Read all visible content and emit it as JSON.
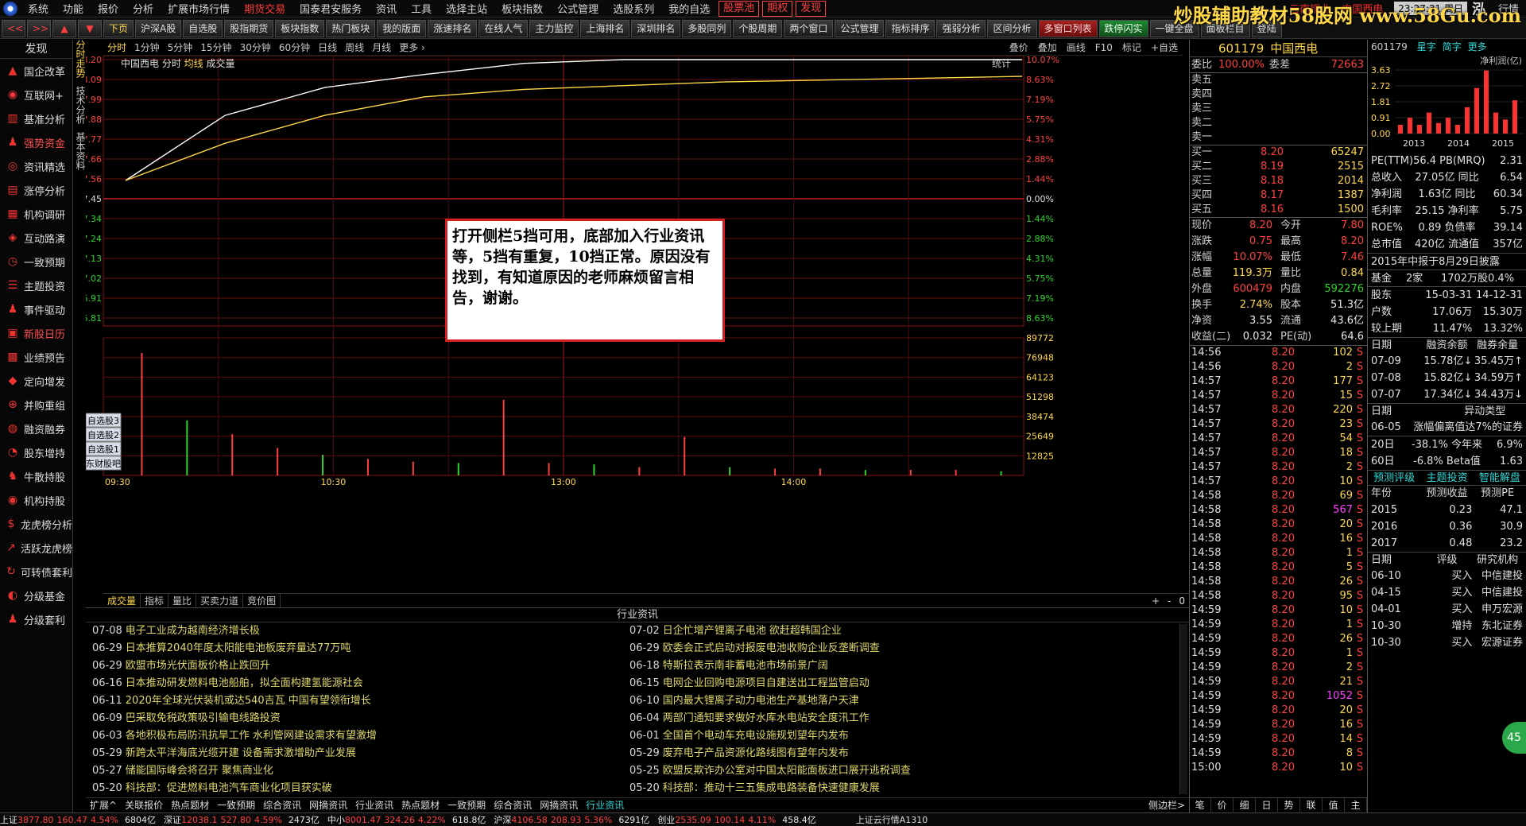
{
  "menubar": {
    "items": [
      "系统",
      "功能",
      "报价",
      "分析",
      "扩展市场行情",
      "期货交易",
      "国泰君安服务",
      "资讯",
      "工具",
      "选择主站",
      "板块指数",
      "公式管理",
      "选股系列",
      "我的自选"
    ],
    "red_items": [
      "期货交易"
    ],
    "boxed_items": [
      "股票池",
      "期权",
      "发现"
    ],
    "ticker": [
      "云南铜业",
      "中国西电"
    ],
    "clock": "23:27:31 周日",
    "brand": "泓",
    "market_tab": "行情"
  },
  "watermark": "炒股辅助教材58股网 www.58Gu.com",
  "toolbar": {
    "nav": [
      "<<",
      ">>",
      "▲",
      "▼"
    ],
    "buttons": [
      "下页",
      "沪深A股",
      "自选股",
      "股指期货",
      "板块指数",
      "热门板块",
      "我的版面",
      "涨速排名",
      "在线人气",
      "主力监控",
      "上海排名",
      "深圳排名",
      "多股同列",
      "个股周期",
      "两个窗口",
      "公式管理",
      "指标排序",
      "强弱分析",
      "区间分析"
    ],
    "red_button": "多窗口列表",
    "green_button": "跌停闪实",
    "tail_buttons": [
      "一键全盘",
      "面板栏目",
      "登陆"
    ]
  },
  "sidebar": {
    "header": "发现",
    "items": [
      {
        "icon": "chart-icon",
        "label": "国企改革"
      },
      {
        "icon": "globe-icon",
        "label": "互联网+"
      },
      {
        "icon": "bars-icon",
        "label": "基准分析"
      },
      {
        "icon": "person-icon",
        "label": "强势资金"
      },
      {
        "icon": "target-icon",
        "label": "资讯精选"
      },
      {
        "icon": "doc-icon",
        "label": "涨停分析"
      },
      {
        "icon": "building-icon",
        "label": "机构调研"
      },
      {
        "icon": "bag-icon",
        "label": "互动路演"
      },
      {
        "icon": "alarm-icon",
        "label": "一致预期"
      },
      {
        "icon": "list-icon",
        "label": "主题投资"
      },
      {
        "icon": "person-icon",
        "label": "事件驱动"
      },
      {
        "icon": "calendar-icon",
        "label": "新股日历"
      },
      {
        "icon": "grid-icon",
        "label": "业绩预告"
      },
      {
        "icon": "tag-icon",
        "label": "定向增发"
      },
      {
        "icon": "merge-icon",
        "label": "并购重组"
      },
      {
        "icon": "coin-icon",
        "label": "融资融券"
      },
      {
        "icon": "pie-icon",
        "label": "股东增持"
      },
      {
        "icon": "bull-icon",
        "label": "牛散持股"
      },
      {
        "icon": "globe-icon",
        "label": "机构持股"
      },
      {
        "icon": "dollar-icon",
        "label": "龙虎榜分析"
      },
      {
        "icon": "line-icon",
        "label": "活跃龙虎榜"
      },
      {
        "icon": "cycle-icon",
        "label": "可转债套利"
      },
      {
        "icon": "fund-icon",
        "label": "分级基金"
      },
      {
        "icon": "person-icon",
        "label": "分级套利"
      }
    ]
  },
  "vtabs": [
    "分时走势",
    "技术分析",
    "基本资料"
  ],
  "period": {
    "tabs": [
      "分时",
      "1分钟",
      "5分钟",
      "15分钟",
      "30分钟",
      "60分钟",
      "日线",
      "周线",
      "月线",
      "更多 ›"
    ],
    "active": "分时",
    "tools": [
      "叠价",
      "叠加",
      "画线",
      "F10",
      "标记",
      "+自选"
    ]
  },
  "chart": {
    "legend": {
      "name": "中国西电",
      "view": "分时",
      "avg": "均线",
      "vol": "成交量"
    },
    "stat_label": "统计",
    "y_labels": [
      "8.20",
      "8.09",
      "7.99",
      "7.88",
      "7.77",
      "7.66",
      "7.56",
      "7.45",
      "7.34",
      "7.24",
      "7.13",
      "7.02",
      "6.91",
      "6.81"
    ],
    "pct_labels": [
      "10.07%",
      "8.63%",
      "7.19%",
      "5.75%",
      "4.31%",
      "2.88%",
      "1.44%",
      "0.00%",
      "1.44%",
      "2.88%",
      "4.31%",
      "5.75%",
      "7.19%",
      "8.63%"
    ],
    "vol_labels": [
      "89772",
      "76948",
      "64123",
      "51298",
      "38474",
      "25649",
      "12825"
    ],
    "time_labels": [
      "09:30",
      "10:30",
      "13:00",
      "14:00"
    ],
    "selfselect": [
      "自选股3",
      "自选股2",
      "自选股1",
      "东财股吧"
    ]
  },
  "chart_data": {
    "type": "line",
    "x": [
      "09:30",
      "10:30",
      "13:00",
      "14:00",
      "15:00"
    ],
    "ylim": [
      6.7,
      8.2
    ],
    "prev_close": 7.45,
    "series": [
      {
        "values": [
          7.55,
          7.9,
          8.05,
          8.12,
          8.18,
          8.2,
          8.2,
          8.2,
          8.2,
          8.2
        ]
      },
      {
        "values": [
          7.55,
          7.75,
          7.9,
          8.0,
          8.04,
          8.06,
          8.08,
          8.09,
          8.1,
          8.11
        ]
      }
    ],
    "volume": [
      89000,
      40000,
      30000,
      20000,
      15000,
      12000,
      10000,
      9000,
      55000,
      9000,
      8000,
      6000,
      28000,
      6000,
      5000,
      5000,
      4000,
      4000,
      4000,
      3000
    ]
  },
  "bottom_tabs": {
    "items": [
      "成交量",
      "指标",
      "量比",
      "买卖力道",
      "竞价图"
    ],
    "active": "成交量",
    "zoom": [
      "+",
      "-",
      "0"
    ]
  },
  "news": {
    "title": "行业资讯",
    "left": [
      {
        "date": "07-08",
        "text": "电子工业成为越南经济增长极"
      },
      {
        "date": "06-29",
        "text": "日本推算2040年度太阳能电池板废弃量达77万吨"
      },
      {
        "date": "06-29",
        "text": "欧盟市场光伏面板价格止跌回升"
      },
      {
        "date": "06-16",
        "text": "日本推动研发燃料电池船舶，拟全面构建氢能源社会"
      },
      {
        "date": "06-11",
        "text": "2020年全球光伏装机或达540吉瓦 中国有望领衔增长"
      },
      {
        "date": "06-09",
        "text": "巴采取免税政策吸引输电线路投资"
      },
      {
        "date": "06-03",
        "text": "各地积极布局防汛抗旱工作 水利管网建设需求有望激增"
      },
      {
        "date": "05-29",
        "text": "新跨太平洋海底光缆开建 设备需求激增助产业发展"
      },
      {
        "date": "05-27",
        "text": "储能国际峰会将召开 聚焦商业化"
      },
      {
        "date": "05-20",
        "text": "科技部：促进燃料电池汽车商业化项目获实破"
      }
    ],
    "right": [
      {
        "date": "07-02",
        "text": "日企忙增产锂离子电池 欲赶超韩国企业"
      },
      {
        "date": "06-29",
        "text": "欧委会正式启动对报废电池收购企业反垄断调查"
      },
      {
        "date": "06-18",
        "text": "特斯拉表示南非蓄电池市场前景广阔"
      },
      {
        "date": "06-15",
        "text": "电网企业回购电源项目自建送出工程监管启动"
      },
      {
        "date": "06-10",
        "text": "国内最大锂离子动力电池生产基地落户天津"
      },
      {
        "date": "06-04",
        "text": "两部门通知要求做好水库水电站安全度汛工作"
      },
      {
        "date": "06-01",
        "text": "全国首个电动车充电设施规划望年内发布"
      },
      {
        "date": "05-29",
        "text": "废弃电子产品资源化路线图有望年内发布"
      },
      {
        "date": "05-25",
        "text": "欧盟反欺诈办公室对中国太阳能面板进口展开逃税调查"
      },
      {
        "date": "05-20",
        "text": "科技部：推动十三五集成电路装备快速健康发展"
      }
    ]
  },
  "news_tabs": {
    "items": [
      "扩展^",
      "关联报价",
      "热点题材",
      "一致预期",
      "综合资讯",
      "网摘资讯",
      "行业资讯",
      "热点题材",
      "一致预期",
      "综合资讯",
      "网摘资讯",
      "行业资讯"
    ],
    "active_index": 11,
    "right": "侧边栏>"
  },
  "quote": {
    "code": "601179",
    "name": "中国西电",
    "webi": {
      "label1": "委比",
      "val1": "100.00%",
      "label2": "委差",
      "val2": "72663"
    },
    "sell": [
      "卖五",
      "卖四",
      "卖三",
      "卖二",
      "卖一"
    ],
    "buy": [
      {
        "l": "买一",
        "p": "8.20",
        "v": "65247"
      },
      {
        "l": "买二",
        "p": "8.19",
        "v": "2515"
      },
      {
        "l": "买三",
        "p": "8.18",
        "v": "2014"
      },
      {
        "l": "买四",
        "p": "8.17",
        "v": "1387"
      },
      {
        "l": "买五",
        "p": "8.16",
        "v": "1500"
      }
    ],
    "stats": [
      {
        "k": "现价",
        "v": "8.20",
        "vc": "red",
        "k2": "今开",
        "v2": "7.80",
        "v2c": "red"
      },
      {
        "k": "涨跌",
        "v": "0.75",
        "vc": "red",
        "k2": "最高",
        "v2": "8.20",
        "v2c": "red"
      },
      {
        "k": "涨幅",
        "v": "10.07%",
        "vc": "red",
        "k2": "最低",
        "v2": "7.46",
        "v2c": "red"
      },
      {
        "k": "总量",
        "v": "119.3万",
        "vc": "yel",
        "k2": "量比",
        "v2": "0.84",
        "v2c": "yel"
      },
      {
        "k": "外盘",
        "v": "600479",
        "vc": "red",
        "k2": "内盘",
        "v2": "592276",
        "v2c": "grn"
      },
      {
        "k": "换手",
        "v": "2.74%",
        "vc": "yel",
        "k2": "股本",
        "v2": "51.3亿",
        "v2c": "wht"
      },
      {
        "k": "净资",
        "v": "3.55",
        "vc": "wht",
        "k2": "流通",
        "v2": "43.6亿",
        "v2c": "wht"
      },
      {
        "k": "收益(二)",
        "v": "0.032",
        "vc": "wht",
        "k2": "PE(动)",
        "v2": "64.6",
        "v2c": "wht"
      }
    ],
    "ticks": [
      {
        "t": "14:56",
        "p": "8.20",
        "v": "102",
        "s": "S",
        "m": false
      },
      {
        "t": "14:56",
        "p": "8.20",
        "v": "2",
        "s": "S",
        "m": false
      },
      {
        "t": "14:57",
        "p": "8.20",
        "v": "177",
        "s": "S",
        "m": false
      },
      {
        "t": "14:57",
        "p": "8.20",
        "v": "15",
        "s": "S",
        "m": false
      },
      {
        "t": "14:57",
        "p": "8.20",
        "v": "220",
        "s": "S",
        "m": false
      },
      {
        "t": "14:57",
        "p": "8.20",
        "v": "23",
        "s": "S",
        "m": false
      },
      {
        "t": "14:57",
        "p": "8.20",
        "v": "54",
        "s": "S",
        "m": false
      },
      {
        "t": "14:57",
        "p": "8.20",
        "v": "18",
        "s": "S",
        "m": false
      },
      {
        "t": "14:57",
        "p": "8.20",
        "v": "2",
        "s": "S",
        "m": false
      },
      {
        "t": "14:57",
        "p": "8.20",
        "v": "10",
        "s": "S",
        "m": false
      },
      {
        "t": "14:58",
        "p": "8.20",
        "v": "69",
        "s": "S",
        "m": false
      },
      {
        "t": "14:58",
        "p": "8.20",
        "v": "567",
        "s": "S",
        "m": true
      },
      {
        "t": "14:58",
        "p": "8.20",
        "v": "20",
        "s": "S",
        "m": false
      },
      {
        "t": "14:58",
        "p": "8.20",
        "v": "16",
        "s": "S",
        "m": false
      },
      {
        "t": "14:58",
        "p": "8.20",
        "v": "1",
        "s": "S",
        "m": false
      },
      {
        "t": "14:58",
        "p": "8.20",
        "v": "5",
        "s": "S",
        "m": false
      },
      {
        "t": "14:58",
        "p": "8.20",
        "v": "26",
        "s": "S",
        "m": false
      },
      {
        "t": "14:58",
        "p": "8.20",
        "v": "95",
        "s": "S",
        "m": false
      },
      {
        "t": "14:59",
        "p": "8.20",
        "v": "10",
        "s": "S",
        "m": false
      },
      {
        "t": "14:59",
        "p": "8.20",
        "v": "1",
        "s": "S",
        "m": false
      },
      {
        "t": "14:59",
        "p": "8.20",
        "v": "26",
        "s": "S",
        "m": false
      },
      {
        "t": "14:59",
        "p": "8.20",
        "v": "1",
        "s": "S",
        "m": false
      },
      {
        "t": "14:59",
        "p": "8.20",
        "v": "2",
        "s": "S",
        "m": false
      },
      {
        "t": "14:59",
        "p": "8.20",
        "v": "21",
        "s": "S",
        "m": false
      },
      {
        "t": "14:59",
        "p": "8.20",
        "v": "1052",
        "s": "S",
        "m": true
      },
      {
        "t": "14:59",
        "p": "8.20",
        "v": "20",
        "s": "S",
        "m": false
      },
      {
        "t": "14:59",
        "p": "8.20",
        "v": "16",
        "s": "S",
        "m": false
      },
      {
        "t": "14:59",
        "p": "8.20",
        "v": "14",
        "s": "S",
        "m": false
      },
      {
        "t": "14:59",
        "p": "8.20",
        "v": "8",
        "s": "S",
        "m": false
      },
      {
        "t": "15:00",
        "p": "8.20",
        "v": "10",
        "s": "S",
        "m": false
      }
    ],
    "bottom_tabs": [
      "笔",
      "价",
      "细",
      "日",
      "势",
      "联",
      "值",
      "主"
    ]
  },
  "f10": {
    "head": "601179",
    "head_tabs": [
      "星字",
      "简字",
      "更多"
    ],
    "bar_label": "净利润(亿)",
    "bar_y": [
      "3.63",
      "2.72",
      "1.81",
      "0.91",
      "0.00"
    ],
    "bar_x": [
      "2013",
      "2014",
      "2015"
    ],
    "bars": [
      0.5,
      0.9,
      0.5,
      1.2,
      0.6,
      0.9,
      0.5,
      1.5,
      2.6,
      3.6,
      1.2,
      0.8,
      1.9
    ],
    "rows": [
      {
        "a": "PE(TTM)",
        "b": "56.4 PB(MRQ)",
        "c": "2.31"
      },
      {
        "a": "总收入",
        "b": "27.05亿 同比",
        "c": "6.54"
      },
      {
        "a": "净利润",
        "b": "1.63亿 同比",
        "c": "60.34"
      },
      {
        "a": "毛利率",
        "b": "25.15 净利率",
        "c": "5.75"
      },
      {
        "a": "ROE%",
        "b": "0.89 负债率",
        "c": "39.14"
      },
      {
        "a": "总市值",
        "b": "420亿 流通值",
        "c": "357亿"
      }
    ],
    "report": "2015年中报于8月29日披露",
    "fund": {
      "a": "基金",
      "b": "2家",
      "c": "1702万股",
      "d": "0.4%"
    },
    "holders": [
      {
        "a": "股东",
        "b": "15-03-31",
        "c": "14-12-31"
      },
      {
        "a": "户数",
        "b": "17.06万",
        "c": "15.30万"
      },
      {
        "a": "较上期",
        "b": "11.47%",
        "c": "13.32%"
      }
    ],
    "margin_head": [
      "日期",
      "融资余额",
      "融券余量"
    ],
    "margin": [
      {
        "a": "07-09",
        "b": "15.78亿↓",
        "c": "35.45万↑"
      },
      {
        "a": "07-08",
        "b": "15.82亿↓",
        "c": "34.59万↑"
      },
      {
        "a": "07-07",
        "b": "17.34亿↓",
        "c": "34.43万↓"
      }
    ],
    "abnormal_head": [
      "日期",
      "异动类型"
    ],
    "abnormal": {
      "a": "06-05",
      "b": "涨幅偏离值达7%的证券"
    },
    "perf": [
      {
        "a": "20日",
        "b": "-38.1% 今年来",
        "c": "6.9%"
      },
      {
        "a": "60日",
        "b": "-6.8% Beta值",
        "c": "1.63"
      }
    ],
    "forecast_tabs": [
      "预测评级",
      "主题投资",
      "智能解盘"
    ],
    "forecast_head": [
      "年份",
      "预测收益",
      "预测PE"
    ],
    "forecast": [
      {
        "a": "2015",
        "b": "0.23",
        "c": "47.1"
      },
      {
        "a": "2016",
        "b": "0.36",
        "c": "30.9"
      },
      {
        "a": "2017",
        "b": "0.48",
        "c": "23.2"
      }
    ],
    "rating_head": [
      "日期",
      "评级",
      "研究机构"
    ],
    "ratings": [
      {
        "a": "06-10",
        "b": "买入",
        "c": "中信建投"
      },
      {
        "a": "04-15",
        "b": "买入",
        "c": "中信建投"
      },
      {
        "a": "04-01",
        "b": "买入",
        "c": "申万宏源"
      },
      {
        "a": "10-30",
        "b": "增持",
        "c": "东北证券"
      },
      {
        "a": "10-30",
        "b": "买入",
        "c": "宏源证券"
      }
    ]
  },
  "status": [
    {
      "name": "上证",
      "val": "3877.80",
      "chg": "160.47",
      "pct": "4.54%",
      "amt": "6804亿"
    },
    {
      "name": "深证",
      "val": "12038.1",
      "chg": "527.80",
      "pct": "4.59%",
      "amt": "2473亿"
    },
    {
      "name": "中小",
      "val": "8001.47",
      "chg": "324.26",
      "pct": "4.22%",
      "amt": "618.8亿"
    },
    {
      "name": "沪深",
      "val": "4106.58",
      "chg": "208.93",
      "pct": "5.36%",
      "amt": "6291亿"
    },
    {
      "name": "创业",
      "val": "2535.09",
      "chg": "100.14",
      "pct": "4.11%",
      "amt": "458.4亿"
    }
  ],
  "status_server": "上证云行情A1310",
  "notice": "打开侧栏5挡可用，底部加入行业资讯等，5挡有重复，10挡正常。原因没有找到，有知道原因的老师麻烦留言相告，谢谢。",
  "chat_icon": "45"
}
